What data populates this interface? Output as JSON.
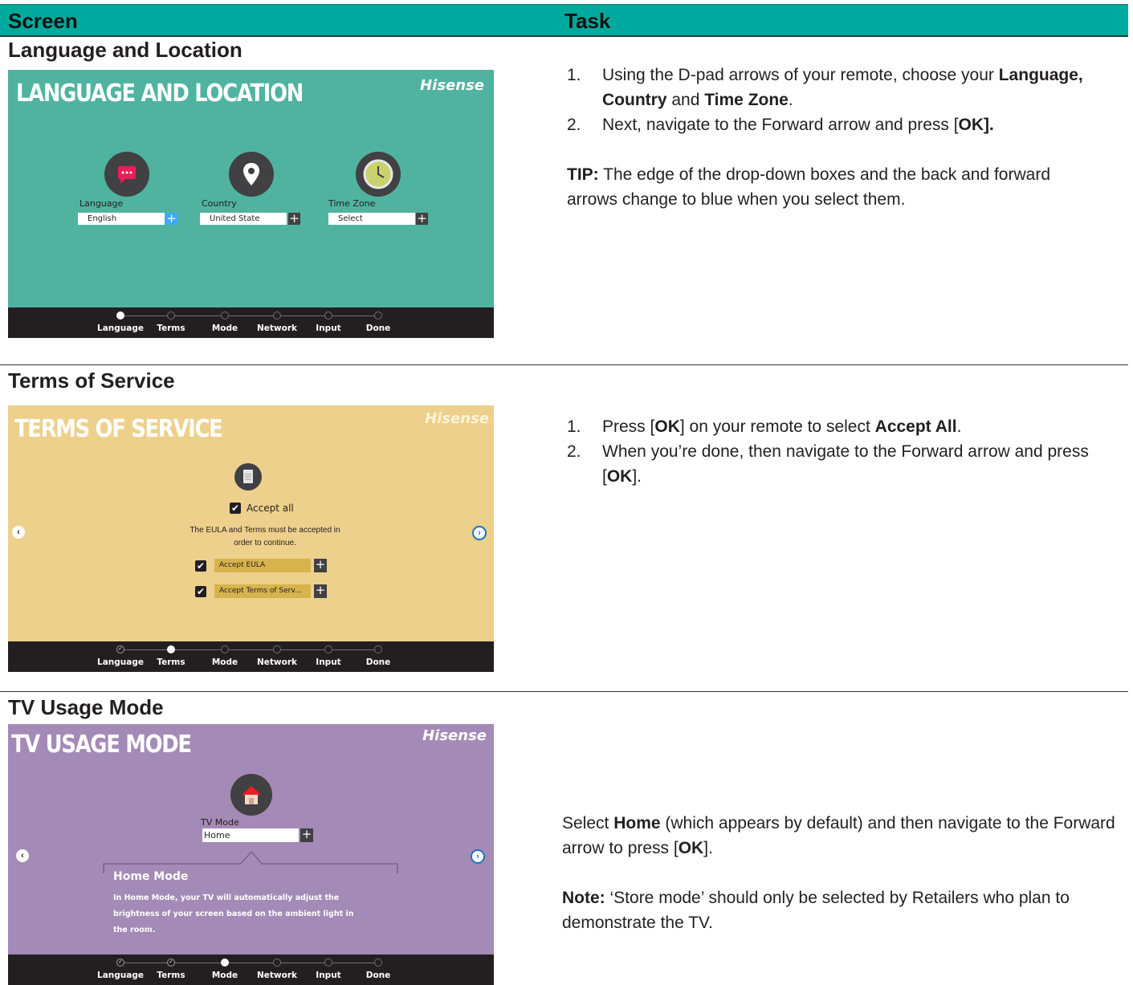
{
  "header": {
    "screen": "Screen",
    "task": "Task"
  },
  "progress_steps": [
    "Language",
    "Terms",
    "Mode",
    "Network",
    "Input",
    "Done"
  ],
  "sections": {
    "language": {
      "title": "Language and Location",
      "screen": {
        "title": "LANGUAGE AND LOCATION",
        "logo": "Hisense",
        "bg_color": "#4fb39f",
        "language_label": "Language",
        "language_value": "English",
        "country_label": "Country",
        "country_value": "United State",
        "timezone_label": "Time Zone",
        "timezone_value": "Select",
        "current_step": 0
      },
      "task": {
        "step1_num": "1.",
        "step1_a": "Using the D-pad arrows of your remote, choose your ",
        "step1_b": "Language, Country",
        "step1_c": " and ",
        "step1_d": "Time Zone",
        "step1_e": ".",
        "step2_num": "2.",
        "step2_a": "Next, navigate to the Forward arrow and press [",
        "step2_b": "OK",
        "step2_c": "].",
        "tip_label": "TIP:",
        "tip_text": " The edge of the drop-down boxes and the back and forward arrows change to blue when you select them."
      }
    },
    "terms": {
      "title": "Terms of Service",
      "screen": {
        "title": "TERMS OF SERVICE",
        "logo": "Hisense",
        "bg_color": "#edd08b",
        "accept_all": "Accept all",
        "notice_line1": "The EULA and Terms must be accepted in",
        "notice_line2": "order to continue.",
        "accept_eula": "Accept EULA",
        "accept_terms": "Accept Terms of Serv...",
        "current_step": 1
      },
      "task": {
        "step1_num": "1.",
        "step1_a": "Press [",
        "step1_b": "OK",
        "step1_c": "] on your remote to select ",
        "step1_d": "Accept All",
        "step1_e": ".",
        "step2_num": "2.",
        "step2_a": "When you’re done, then navigate to the Forward arrow and press [",
        "step2_b": "OK",
        "step2_c": "]."
      }
    },
    "mode": {
      "title": "TV Usage Mode",
      "screen": {
        "title": "TV USAGE MODE",
        "logo": "Hisense",
        "bg_color": "#a48ab6",
        "tvmode_label": "TV Mode",
        "tvmode_value": "Home",
        "desc_title": "Home Mode",
        "desc_line1": "In Home Mode, your TV will automatically adjust the",
        "desc_line2": "brightness of your screen based on the ambient light in",
        "desc_line3": "the room.",
        "current_step": 2
      },
      "task": {
        "p1_a": "Select ",
        "p1_b": "Home",
        "p1_c": " (which appears by default) and then navigate to the Forward arrow to press [",
        "p1_d": "OK",
        "p1_e": "].",
        "note_label": "Note:",
        "note_text": " ‘Store mode’ should only be selected by Retailers who plan to demonstrate the TV."
      }
    }
  }
}
